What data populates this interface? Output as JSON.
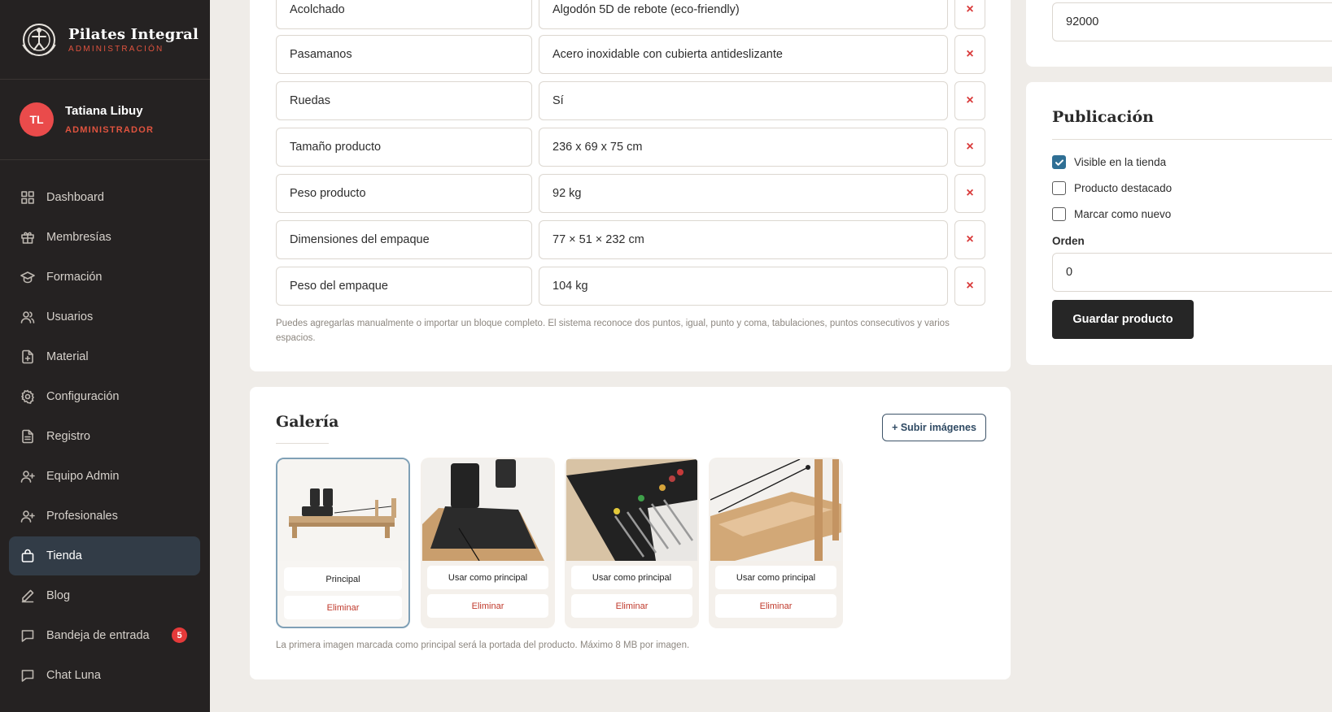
{
  "brand": {
    "title": "Pilates Integral",
    "subtitle": "ADMINISTRACIÓN"
  },
  "user": {
    "initials": "TL",
    "name": "Tatiana Libuy",
    "role": "ADMINISTRADOR"
  },
  "nav": [
    {
      "label": "Dashboard",
      "icon": "grid-icon"
    },
    {
      "label": "Membresías",
      "icon": "gift-icon"
    },
    {
      "label": "Formación",
      "icon": "graduation-cap-icon"
    },
    {
      "label": "Usuarios",
      "icon": "users-icon"
    },
    {
      "label": "Material",
      "icon": "file-plus-icon"
    },
    {
      "label": "Configuración",
      "icon": "gear-icon"
    },
    {
      "label": "Registro",
      "icon": "document-icon"
    },
    {
      "label": "Equipo Admin",
      "icon": "user-plus-icon"
    },
    {
      "label": "Profesionales",
      "icon": "user-plus-icon"
    },
    {
      "label": "Tienda",
      "icon": "shopping-bag-icon",
      "active": true
    },
    {
      "label": "Blog",
      "icon": "pencil-icon"
    },
    {
      "label": "Bandeja de entrada",
      "icon": "message-icon",
      "badge": "5"
    },
    {
      "label": "Chat Luna",
      "icon": "chat-icon"
    }
  ],
  "attributes": [
    {
      "key": "Acolchado",
      "value": "Algodón 5D de rebote (eco-friendly)"
    },
    {
      "key": "Pasamanos",
      "value": "Acero inoxidable con cubierta antideslizante"
    },
    {
      "key": "Ruedas",
      "value": "Sí"
    },
    {
      "key": "Tamaño producto",
      "value": "236 x 69 x 75 cm"
    },
    {
      "key": "Peso producto",
      "value": "92 kg"
    },
    {
      "key": "Dimensiones del empaque",
      "value": "77 × 51 × 232 cm"
    },
    {
      "key": "Peso del empaque",
      "value": "104 kg"
    }
  ],
  "attributes_hint": "Puedes agregarlas manualmente o importar un bloque completo. El sistema reconoce dos puntos, igual, punto y coma, tabulaciones, puntos consecutivos y varios espacios.",
  "delete_symbol": "×",
  "gallery": {
    "title": "Galería",
    "upload_label": "+ Subir imágenes",
    "items": [
      {
        "primary_label": "Principal",
        "delete_label": "Eliminar",
        "is_main": true
      },
      {
        "primary_label": "Usar como principal",
        "delete_label": "Eliminar"
      },
      {
        "primary_label": "Usar como principal",
        "delete_label": "Eliminar"
      },
      {
        "primary_label": "Usar como principal",
        "delete_label": "Eliminar"
      }
    ],
    "hint": "La primera imagen marcada como principal será la portada del producto. Máximo 8 MB por imagen."
  },
  "price": {
    "value": "92000"
  },
  "publication": {
    "title": "Publicación",
    "checks": [
      {
        "label": "Visible en la tienda",
        "checked": true
      },
      {
        "label": "Producto destacado",
        "checked": false
      },
      {
        "label": "Marcar como nuevo",
        "checked": false
      }
    ],
    "order_label": "Orden",
    "order_value": "0",
    "save_label": "Guardar producto"
  }
}
